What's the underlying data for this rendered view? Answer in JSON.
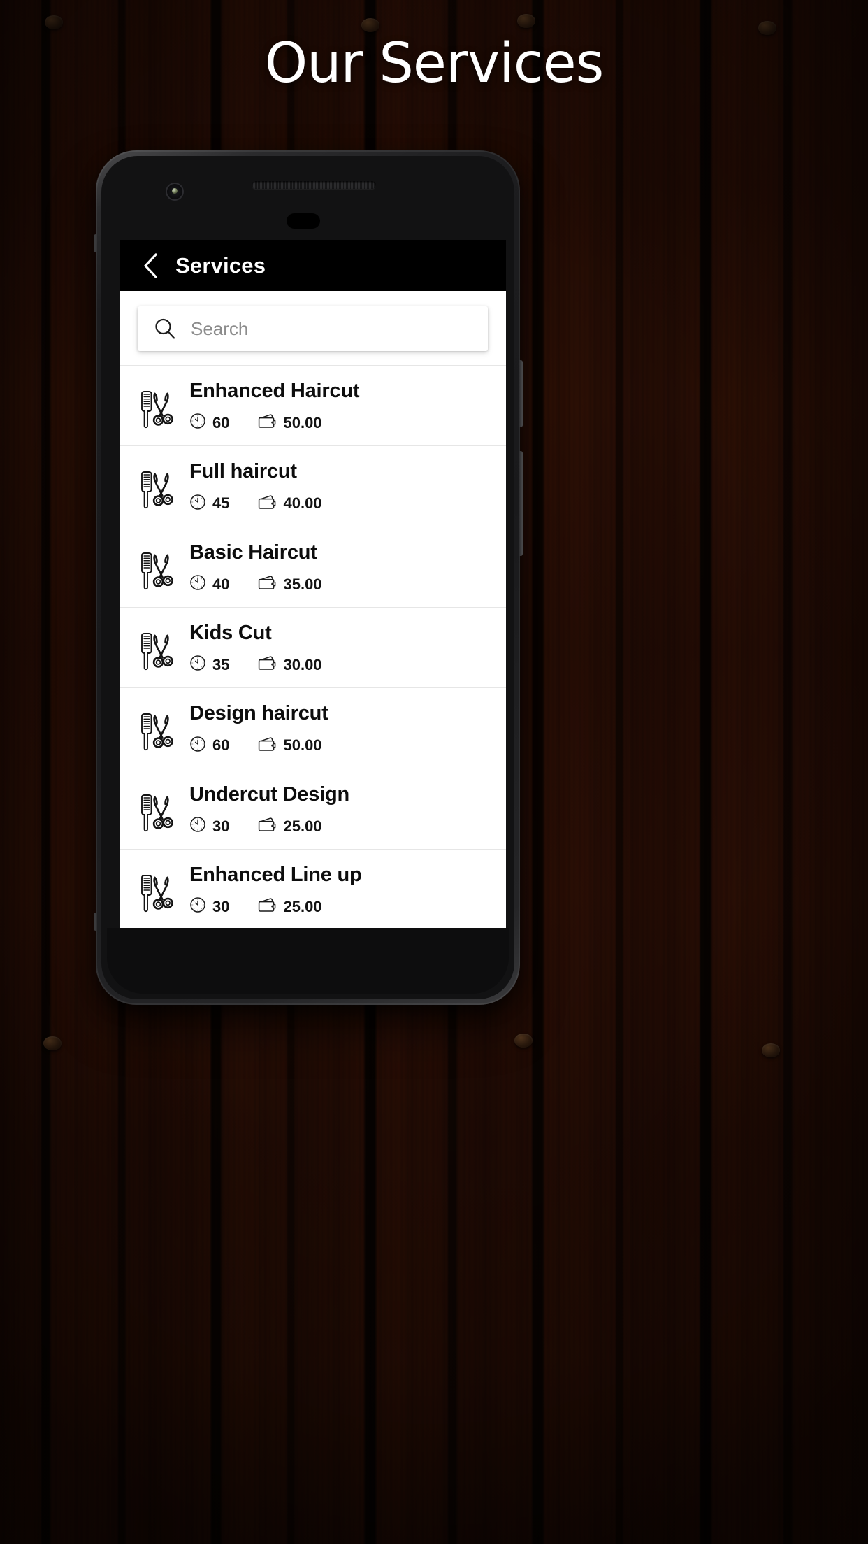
{
  "page": {
    "title": "Our Services",
    "title_color": "#ffffff",
    "background": "wood-planks"
  },
  "device": {
    "frame_color": "#1d1d1f",
    "icons": {
      "front_camera": "camera-icon",
      "earpiece": "speaker-grille-icon",
      "sensor": "sensor-pill-icon"
    }
  },
  "app": {
    "app_bar": {
      "back_icon": "chevron-left-icon",
      "title": "Services",
      "background": "#000000",
      "text_color": "#ffffff"
    },
    "search": {
      "icon": "search-icon",
      "value": "",
      "placeholder": "Search"
    },
    "list": {
      "item_icon": "comb-scissors-icon",
      "duration_icon": "clock-icon",
      "price_icon": "wallet-icon",
      "items": [
        {
          "name": "Enhanced Haircut",
          "duration": "60",
          "price": "50.00"
        },
        {
          "name": "Full haircut",
          "duration": "45",
          "price": "40.00"
        },
        {
          "name": "Basic Haircut",
          "duration": "40",
          "price": "35.00"
        },
        {
          "name": "Kids Cut",
          "duration": "35",
          "price": "30.00"
        },
        {
          "name": "Design haircut",
          "duration": "60",
          "price": "50.00"
        },
        {
          "name": "Undercut Design",
          "duration": "30",
          "price": "25.00"
        },
        {
          "name": "Enhanced Line up",
          "duration": "30",
          "price": "25.00"
        }
      ]
    }
  }
}
